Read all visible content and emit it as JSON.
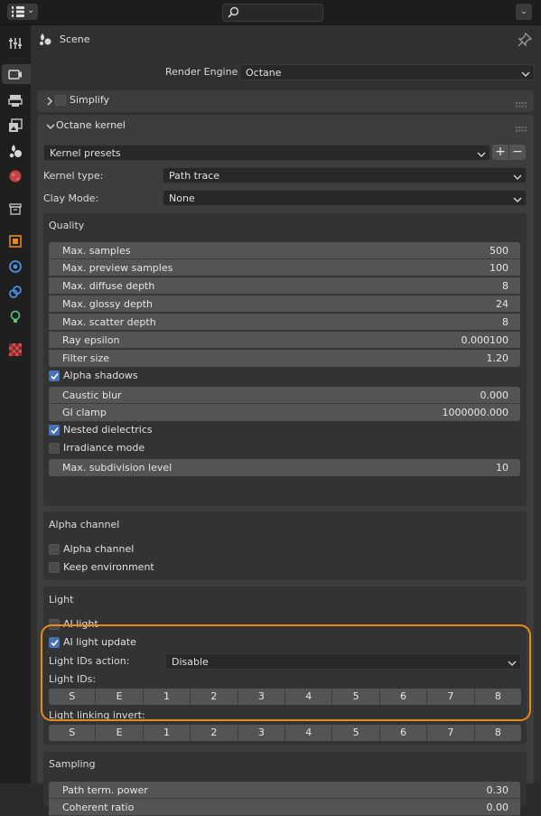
{
  "header": {
    "title": "Scene",
    "render_engine_label": "Render Engine",
    "render_engine_value": "Octane"
  },
  "simplify": {
    "title": "Simplify"
  },
  "octane_kernel": {
    "title": "Octane kernel",
    "presets_value": "Kernel presets",
    "kernel_type_label": "Kernel type:",
    "kernel_type_value": "Path trace",
    "clay_mode_label": "Clay Mode:",
    "clay_mode_value": "None"
  },
  "quality": {
    "title": "Quality",
    "fields": [
      {
        "label": "Max. samples",
        "value": "500"
      },
      {
        "label": "Max. preview samples",
        "value": "100"
      },
      {
        "label": "Max. diffuse depth",
        "value": "8"
      },
      {
        "label": "Max. glossy depth",
        "value": "24"
      },
      {
        "label": "Max. scatter depth",
        "value": "8"
      },
      {
        "label": "Ray epsilon",
        "value": "0.000100"
      },
      {
        "label": "Filter size",
        "value": "1.20"
      }
    ],
    "alpha_shadows": "Alpha shadows",
    "fields2": [
      {
        "label": "Caustic blur",
        "value": "0.000"
      },
      {
        "label": "GI clamp",
        "value": "1000000.000"
      }
    ],
    "nested_dielectrics": "Nested dielectrics",
    "irradiance_mode": "Irradiance mode",
    "max_subdivision": {
      "label": "Max. subdivision level",
      "value": "10"
    }
  },
  "alpha_channel": {
    "title": "Alpha channel",
    "alpha_channel": "Alpha channel",
    "keep_environment": "Keep environment"
  },
  "light": {
    "title": "Light",
    "ai_light": "AI light",
    "ai_light_update": "AI light update",
    "light_ids_action_label": "Light IDs action:",
    "light_ids_action_value": "Disable",
    "light_ids_label": "Light IDs:",
    "light_ids": [
      "S",
      "E",
      "1",
      "2",
      "3",
      "4",
      "5",
      "6",
      "7",
      "8"
    ],
    "light_linking_invert_label": "Light linking invert:",
    "light_linking": [
      "S",
      "E",
      "1",
      "2",
      "3",
      "4",
      "5",
      "6",
      "7",
      "8"
    ]
  },
  "sampling": {
    "title": "Sampling",
    "fields": [
      {
        "label": "Path term. power",
        "value": "0.30"
      },
      {
        "label": "Coherent ratio",
        "value": "0.00"
      }
    ]
  },
  "colors": {
    "accent": "#4772b3",
    "highlight": "#e88a1a"
  }
}
